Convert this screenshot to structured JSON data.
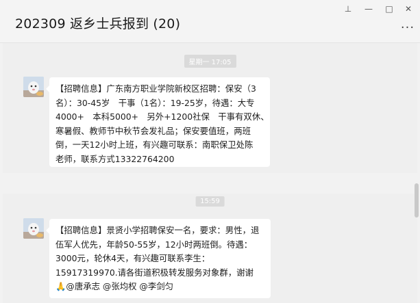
{
  "window": {
    "title": "202309 返乡士兵报到 (20)",
    "controls": {
      "pin": "⊥",
      "minimize": "—",
      "maximize": "□",
      "close": "✕"
    },
    "more": "···"
  },
  "messages": [
    {
      "time": "星期一 17:05",
      "lines": [
        "【招聘信息】广东南方职业学院新校区招聘：保安（3",
        "名）：30-45岁　干事（1名）：19-25岁，待遇：大专",
        "4000+　本科5000+　另外+1200社保　干事有双休、",
        "寒暑假、教师节中秋节会发礼品；保安要值班，两班",
        "倒，一天12小时上班，有兴趣可联系：南职保卫处陈",
        "老师，联系方式13322764200"
      ]
    },
    {
      "time": "15:59",
      "lines": [
        "【招聘信息】景贤小学招聘保安一名，要求：男性，退",
        "伍军人优先，年龄50-55岁，12小时两班倒。待遇：",
        "3000元，轮休4天，有兴趣可联系李生：",
        "15917319970.请各街道积极转发服务对象群，谢谢",
        "🙏@唐承志 @张均权 @李剑匀"
      ]
    }
  ],
  "colors": {
    "background": "#f2f2f2",
    "bubble": "#ffffff",
    "timestamp_pill": "#dadada"
  }
}
